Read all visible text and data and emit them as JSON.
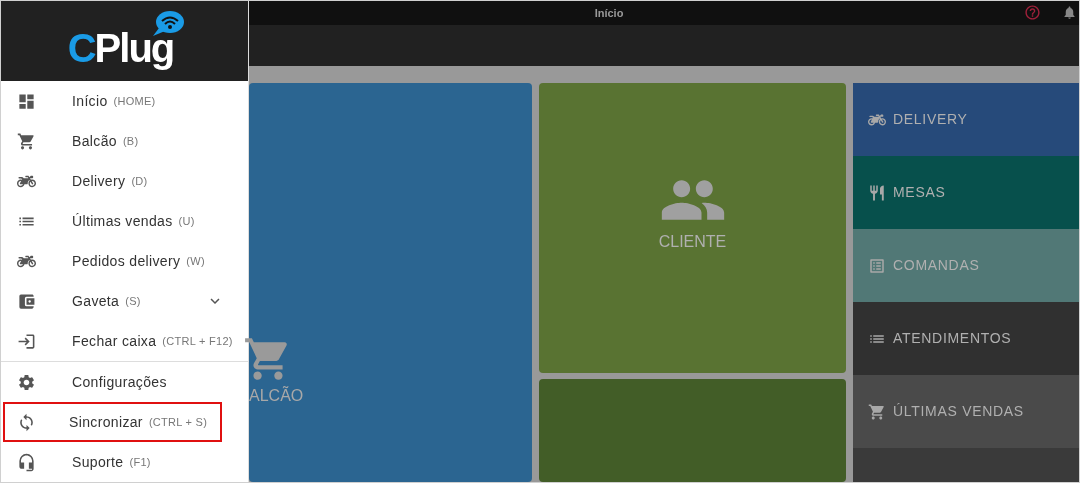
{
  "logo": {
    "initial": "C",
    "word": "Plug"
  },
  "menu": [
    {
      "label": "Início",
      "shortcut": "(HOME)"
    },
    {
      "label": "Balcão",
      "shortcut": "(B)"
    },
    {
      "label": "Delivery",
      "shortcut": "(D)"
    },
    {
      "label": "Últimas vendas",
      "shortcut": "(U)"
    },
    {
      "label": "Pedidos delivery",
      "shortcut": "(W)"
    },
    {
      "label": "Gaveta",
      "shortcut": "(S)",
      "expanded": false
    },
    {
      "label": "Fechar caixa",
      "shortcut": "(CTRL + F12)",
      "divider_after": true
    },
    {
      "label": "Configurações"
    },
    {
      "label": "Sincronizar",
      "shortcut": "(CTRL + S)",
      "highlighted": true
    },
    {
      "label": "Suporte",
      "shortcut": "(F1)"
    }
  ],
  "window": {
    "title": "Início"
  },
  "tiles": {
    "balcao": {
      "label": "ALCÃO"
    },
    "cliente": {
      "label": "CLIENTE"
    }
  },
  "side_tiles": [
    {
      "label": "DELIVERY",
      "color": "#264a7a"
    },
    {
      "label": "MESAS",
      "color": "#07504c"
    },
    {
      "label": "COMANDAS",
      "color": "#517876"
    },
    {
      "label": "ATENDIMENTOS",
      "color": "#303030"
    },
    {
      "label": "ÚLTIMAS VENDAS",
      "color": "#4a4a4a"
    }
  ]
}
